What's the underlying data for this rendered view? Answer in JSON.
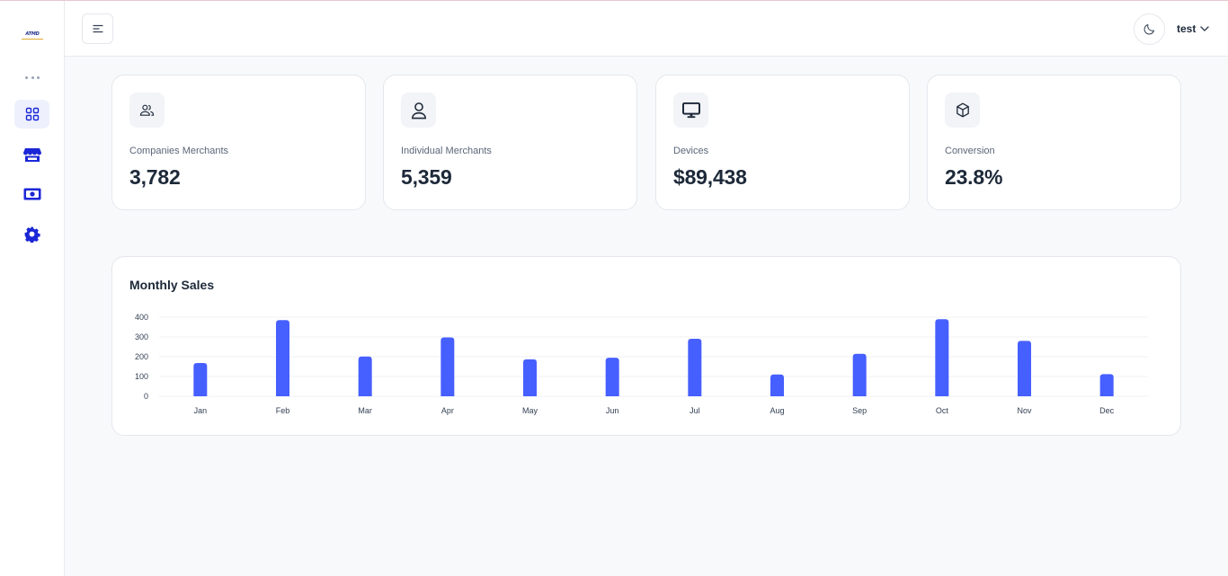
{
  "sidebar": {
    "logo_text": "ATMD",
    "items": [
      {
        "name": "dashboard",
        "icon": "grid-icon",
        "active": true
      },
      {
        "name": "merchants",
        "icon": "store-icon",
        "active": false
      },
      {
        "name": "payments",
        "icon": "cash-icon",
        "active": false
      },
      {
        "name": "settings",
        "icon": "gear-icon",
        "active": false
      }
    ],
    "accent_color": "#1b27d6"
  },
  "header": {
    "menu_icon": "menu-icon",
    "theme_icon": "moon-icon",
    "user_name": "test"
  },
  "stats": [
    {
      "label": "Companies Merchants",
      "value": "3,782",
      "icon": "users-icon"
    },
    {
      "label": "Individual Merchants",
      "value": "5,359",
      "icon": "user-icon"
    },
    {
      "label": "Devices",
      "value": "$89,438",
      "icon": "monitor-icon"
    },
    {
      "label": "Conversion",
      "value": "23.8%",
      "icon": "box-icon"
    }
  ],
  "chart_data": {
    "type": "bar",
    "title": "Monthly Sales",
    "categories": [
      "Jan",
      "Feb",
      "Mar",
      "Apr",
      "May",
      "Jun",
      "Jul",
      "Aug",
      "Sep",
      "Oct",
      "Nov",
      "Dec"
    ],
    "values": [
      168,
      385,
      201,
      298,
      187,
      195,
      291,
      110,
      215,
      390,
      280,
      112
    ],
    "yticks": [
      0,
      100,
      200,
      300,
      400
    ],
    "ylim": [
      0,
      400
    ],
    "grid": true,
    "bar_color": "#465fff"
  }
}
